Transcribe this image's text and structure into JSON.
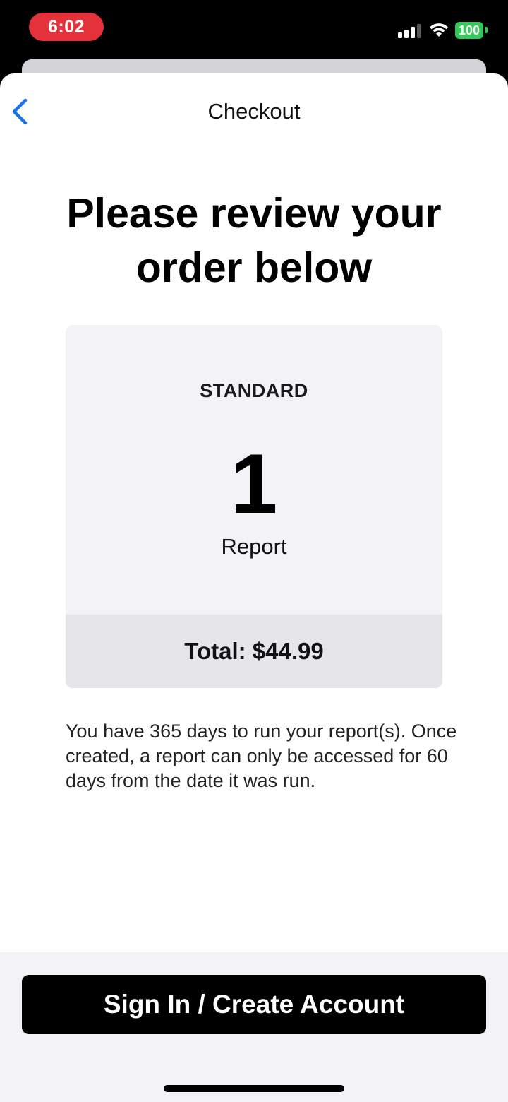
{
  "status_bar": {
    "time": "6:02",
    "battery": "100",
    "icons": [
      "signal-icon",
      "wifi-icon",
      "battery-icon"
    ]
  },
  "nav": {
    "title": "Checkout",
    "back_icon": "chevron-left-icon"
  },
  "headline": "Please review your order below",
  "order": {
    "plan": "STANDARD",
    "count": "1",
    "unit": "Report",
    "total": "Total: $44.99"
  },
  "note": "You have 365 days to run your report(s). Once created, a report can only be accessed for 60 days from the date it was run.",
  "cta": {
    "label": "Sign In / Create Account"
  },
  "colors": {
    "accent": "#1a73e8",
    "status_pill": "#e5313a",
    "battery": "#34c759",
    "card": "#f2f2f7",
    "total_bar": "#e5e5ea",
    "cta": "#000000"
  }
}
